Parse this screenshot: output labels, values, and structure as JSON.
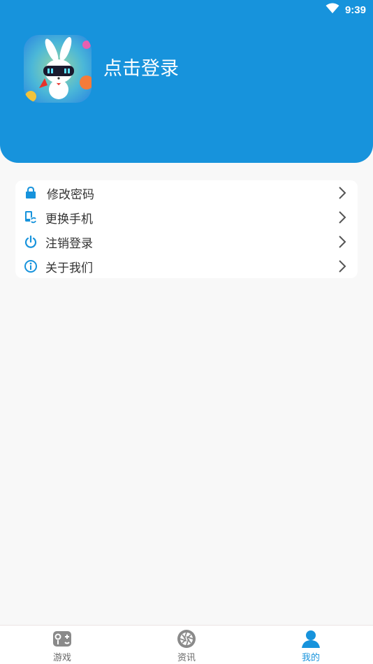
{
  "status_bar": {
    "time": "9:39",
    "icons": [
      "wifi-icon"
    ]
  },
  "profile": {
    "avatar_icon": "rabbit-mascot",
    "login_text": "点击登录"
  },
  "menu": {
    "items": [
      {
        "label": "修改密码",
        "icon": "lock-icon"
      },
      {
        "label": "更换手机",
        "icon": "phone-refresh-icon"
      },
      {
        "label": "注销登录",
        "icon": "power-icon"
      },
      {
        "label": "关于我们",
        "icon": "info-icon"
      }
    ]
  },
  "tabbar": {
    "items": [
      {
        "label": "游戏",
        "icon": "gamepad-icon",
        "active": false
      },
      {
        "label": "资讯",
        "icon": "aperture-icon",
        "active": false
      },
      {
        "label": "我的",
        "icon": "user-icon",
        "active": true
      }
    ]
  },
  "colors": {
    "primary": "#1793dc",
    "background": "#f8f8f8",
    "inactive_icon": "#8a8a8a"
  }
}
